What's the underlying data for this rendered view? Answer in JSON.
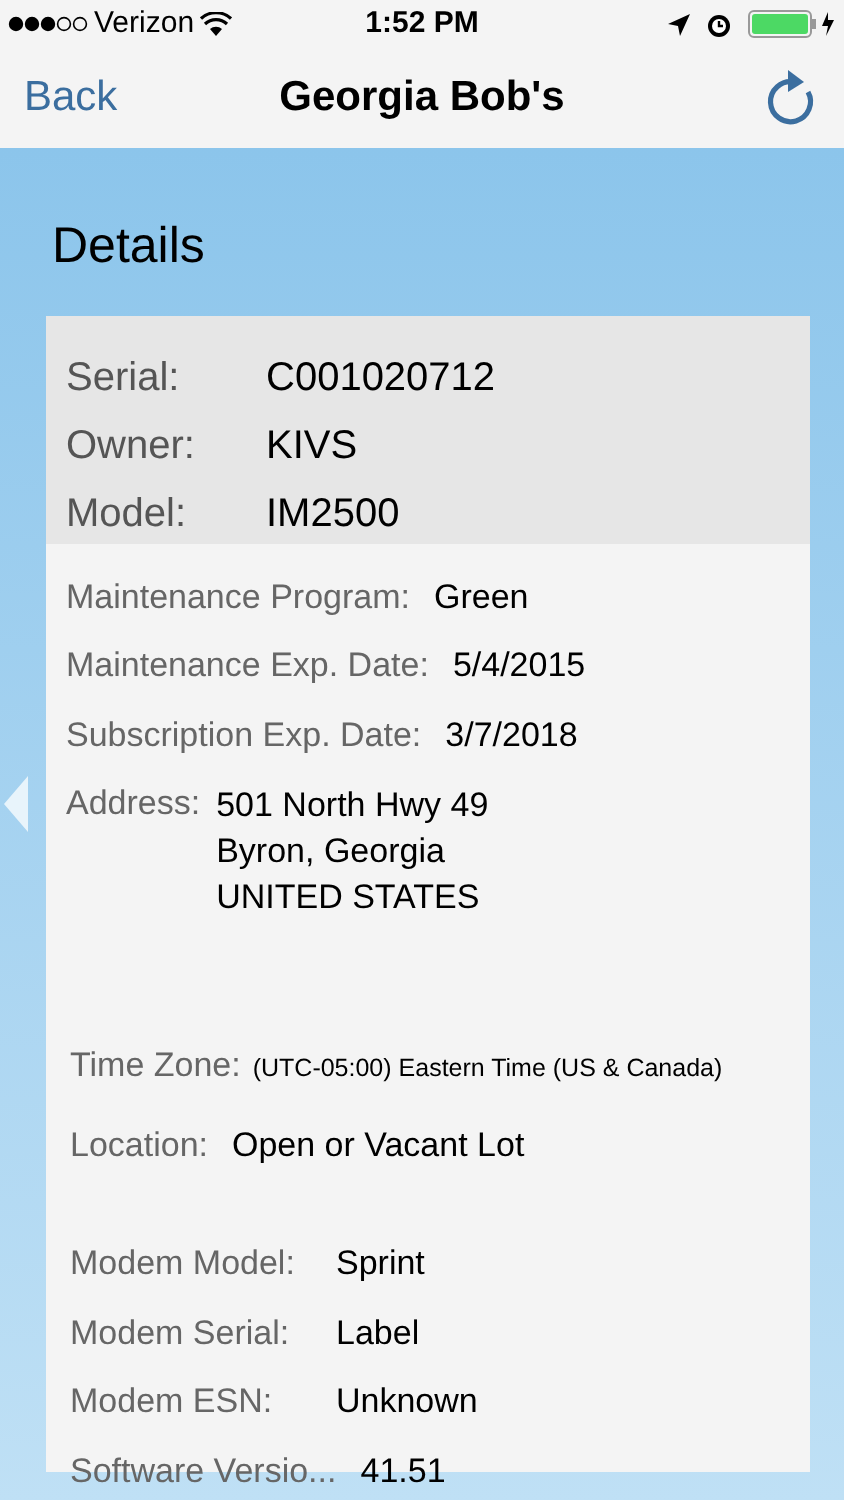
{
  "status_bar": {
    "carrier": "Verizon",
    "time": "1:52 PM"
  },
  "nav": {
    "back": "Back",
    "title": "Georgia Bob's"
  },
  "section_title": "Details",
  "header_fields": [
    {
      "label": "Serial:",
      "value": "C001020712"
    },
    {
      "label": "Owner:",
      "value": "KIVS"
    },
    {
      "label": "Model:",
      "value": "IM2500"
    }
  ],
  "detail_groups": [
    {
      "fields": [
        {
          "kind": "text",
          "label": "Maintenance Program:",
          "value": "Green"
        },
        {
          "kind": "text",
          "label": "Maintenance Exp. Date:",
          "value": "5/4/2015"
        },
        {
          "kind": "text",
          "label": "Subscription Exp. Date:",
          "value": "3/7/2018"
        },
        {
          "kind": "address",
          "label": "Address:",
          "lines": [
            "501 North Hwy 49",
            "Byron, Georgia",
            "UNITED STATES"
          ]
        }
      ]
    },
    {
      "fields": [
        {
          "kind": "small",
          "label": "Time Zone:",
          "value": "(UTC-05:00) Eastern Time (US & Canada)"
        },
        {
          "kind": "text",
          "label": "Location:",
          "value": "Open or Vacant Lot"
        }
      ]
    },
    {
      "fields": [
        {
          "kind": "aligned",
          "label": "Modem Model:",
          "value": "Sprint"
        },
        {
          "kind": "aligned",
          "label": "Modem Serial:",
          "value": "Label"
        },
        {
          "kind": "aligned",
          "label": "Modem ESN:",
          "value": "Unknown"
        },
        {
          "kind": "text",
          "label": "Software Versio...",
          "value": "41.51"
        }
      ]
    }
  ]
}
